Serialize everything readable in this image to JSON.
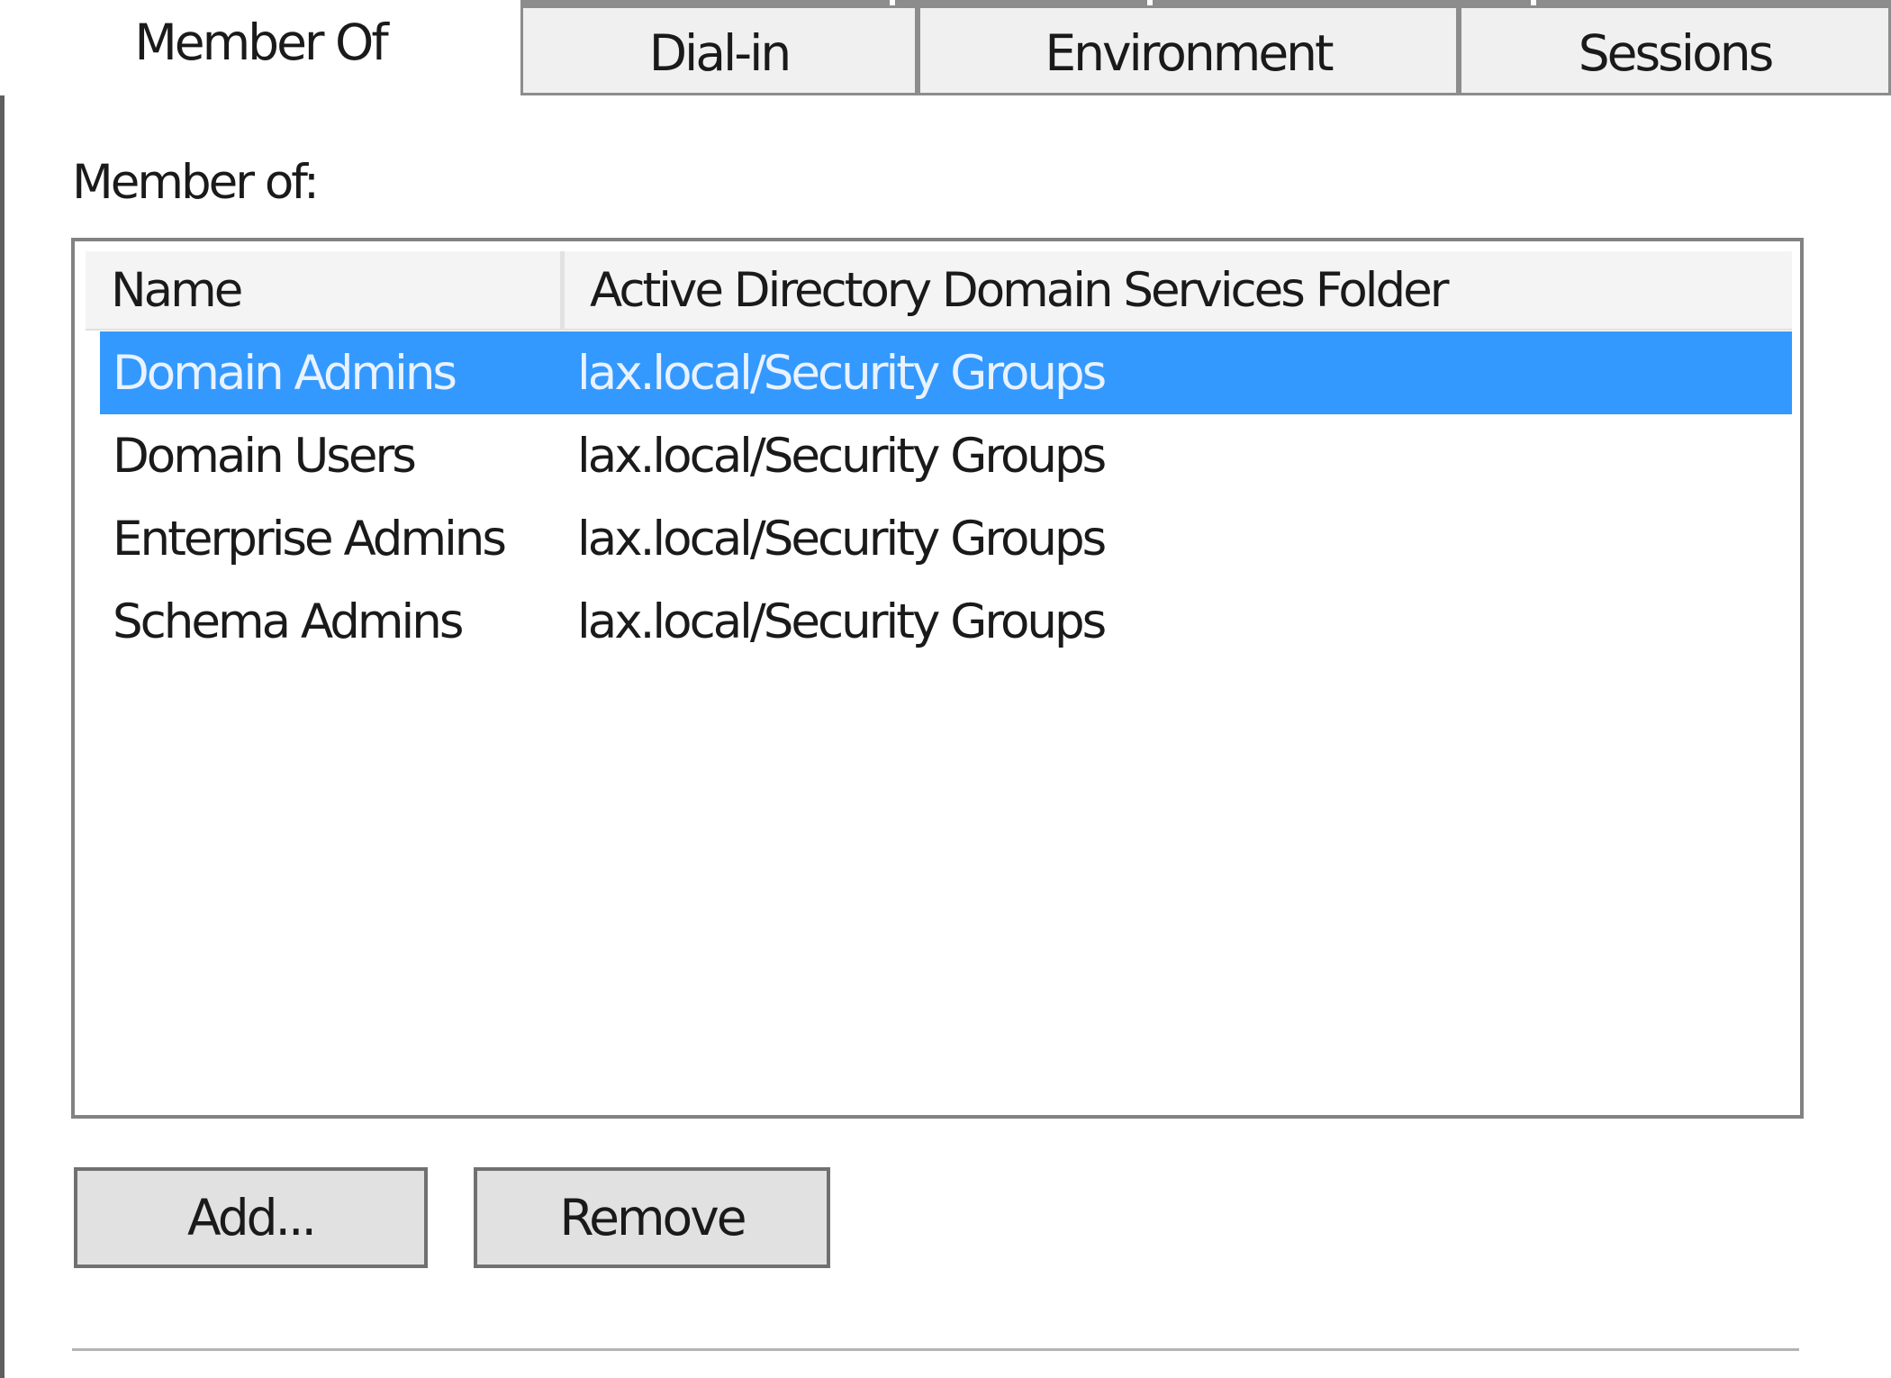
{
  "tabs": {
    "member_of": "Member Of",
    "dial_in": "Dial-in",
    "environment": "Environment",
    "sessions": "Sessions"
  },
  "section_label": "Member of:",
  "list": {
    "columns": {
      "name": "Name",
      "folder": "Active Directory Domain Services Folder"
    },
    "rows": [
      {
        "name": "Domain Admins",
        "folder": "lax.local/Security Groups",
        "selected": true
      },
      {
        "name": "Domain Users",
        "folder": "lax.local/Security Groups",
        "selected": false
      },
      {
        "name": "Enterprise Admins",
        "folder": "lax.local/Security Groups",
        "selected": false
      },
      {
        "name": "Schema Admins",
        "folder": "lax.local/Security Groups",
        "selected": false
      }
    ]
  },
  "buttons": {
    "add": "Add...",
    "remove": "Remove"
  },
  "colors": {
    "selection": "#3399ff",
    "button_face": "#e1e1e1",
    "tab_face": "#f0f0f0"
  }
}
